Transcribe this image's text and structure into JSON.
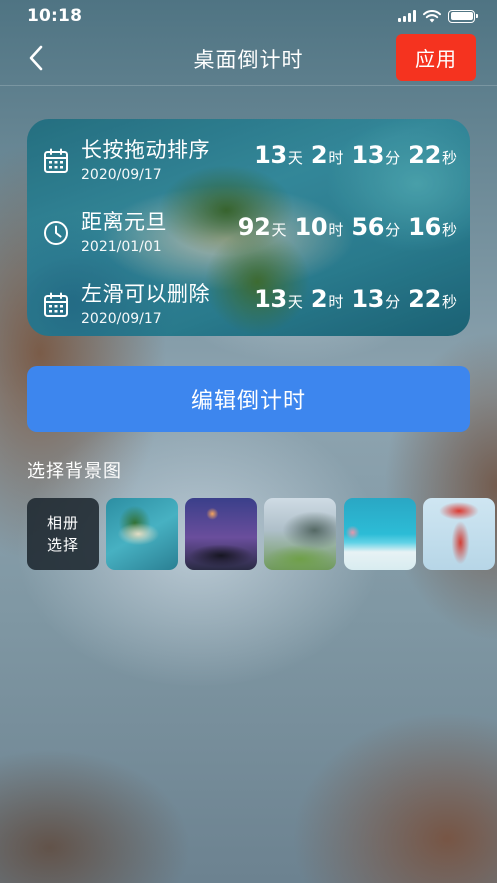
{
  "status_bar": {
    "time": "10:18"
  },
  "nav": {
    "title": "桌面倒计时",
    "apply_label": "应用"
  },
  "countdowns": [
    {
      "name": "长按拖动排序",
      "date": "2020/09/17",
      "icon": "calendar-icon",
      "days": "13",
      "day_unit": "天",
      "hours": "2",
      "hour_unit": "时",
      "minutes": "13",
      "minute_unit": "分",
      "seconds": "22",
      "second_unit": "秒"
    },
    {
      "name": "距离元旦",
      "date": "2021/01/01",
      "icon": "clock-icon",
      "days": "92",
      "day_unit": "天",
      "hours": "10",
      "hour_unit": "时",
      "minutes": "56",
      "minute_unit": "分",
      "seconds": "16",
      "second_unit": "秒"
    },
    {
      "name": "左滑可以删除",
      "date": "2020/09/17",
      "icon": "calendar-icon",
      "days": "13",
      "day_unit": "天",
      "hours": "2",
      "hour_unit": "时",
      "minutes": "13",
      "minute_unit": "分",
      "seconds": "22",
      "second_unit": "秒"
    }
  ],
  "edit_button_label": "编辑倒计时",
  "background_section": {
    "label": "选择背景图",
    "album_line1": "相册",
    "album_line2": "选择"
  },
  "colors": {
    "apply": "#f5331f",
    "edit": "#3d86ee"
  }
}
